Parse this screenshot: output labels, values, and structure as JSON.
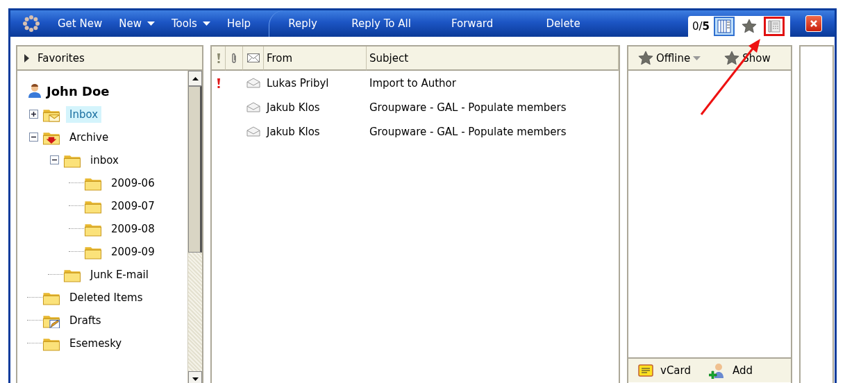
{
  "toolbar": {
    "menu": [
      {
        "label": "Get New",
        "dropdown": false
      },
      {
        "label": "New",
        "dropdown": true
      },
      {
        "label": "Tools",
        "dropdown": true
      },
      {
        "label": "Help",
        "dropdown": false
      }
    ],
    "actions": [
      "Reply",
      "Reply To All",
      "Forward",
      "Delete"
    ],
    "counter": "0/**5**",
    "views": [
      {
        "kind": "columns",
        "selected": true,
        "highlighted": false
      },
      {
        "kind": "star",
        "selected": false,
        "highlighted": false
      },
      {
        "kind": "phone",
        "selected": false,
        "highlighted": true
      }
    ]
  },
  "folders": {
    "favorites": "Favorites",
    "account": "John Doe",
    "tree": [
      {
        "label": "Inbox",
        "kind": "mail",
        "selected": true,
        "expanded": false
      },
      {
        "label": "Archive",
        "kind": "archive",
        "selected": false,
        "expanded": true,
        "children": [
          {
            "label": "inbox",
            "kind": "folder",
            "selected": false,
            "expanded": true,
            "children": [
              {
                "label": "2009-06",
                "kind": "folder",
                "selected": false
              },
              {
                "label": "2009-07",
                "kind": "folder",
                "selected": false
              },
              {
                "label": "2009-08",
                "kind": "folder",
                "selected": false
              },
              {
                "label": "2009-09",
                "kind": "folder",
                "selected": false
              }
            ]
          },
          {
            "label": "Junk E-mail",
            "kind": "folder",
            "selected": false
          }
        ]
      },
      {
        "label": "Deleted Items",
        "kind": "folder",
        "selected": false
      },
      {
        "label": "Drafts",
        "kind": "drafts",
        "selected": false
      },
      {
        "label": "Esemesky",
        "kind": "folder",
        "selected": false
      }
    ]
  },
  "messages": {
    "columns": [
      {
        "kind": "priority"
      },
      {
        "kind": "attachment"
      },
      {
        "kind": "status"
      },
      {
        "kind": "text",
        "label": "From"
      },
      {
        "kind": "text",
        "label": "Subject"
      }
    ],
    "rows": [
      {
        "flagged": true,
        "from": "Lukas Pribyl",
        "subject": "Import  to Author"
      },
      {
        "flagged": false,
        "from": "Jakub Klos",
        "subject": "Groupware - GAL - Populate members"
      },
      {
        "flagged": false,
        "from": "Jakub Klos",
        "subject": "Groupware - GAL - Populate members"
      }
    ]
  },
  "contacts": {
    "status": "Offline",
    "show": "Show",
    "footer": [
      {
        "kind": "vcard",
        "label": "vCard"
      },
      {
        "kind": "add",
        "label": "Add"
      }
    ]
  },
  "annotation": {
    "arrow": true
  }
}
